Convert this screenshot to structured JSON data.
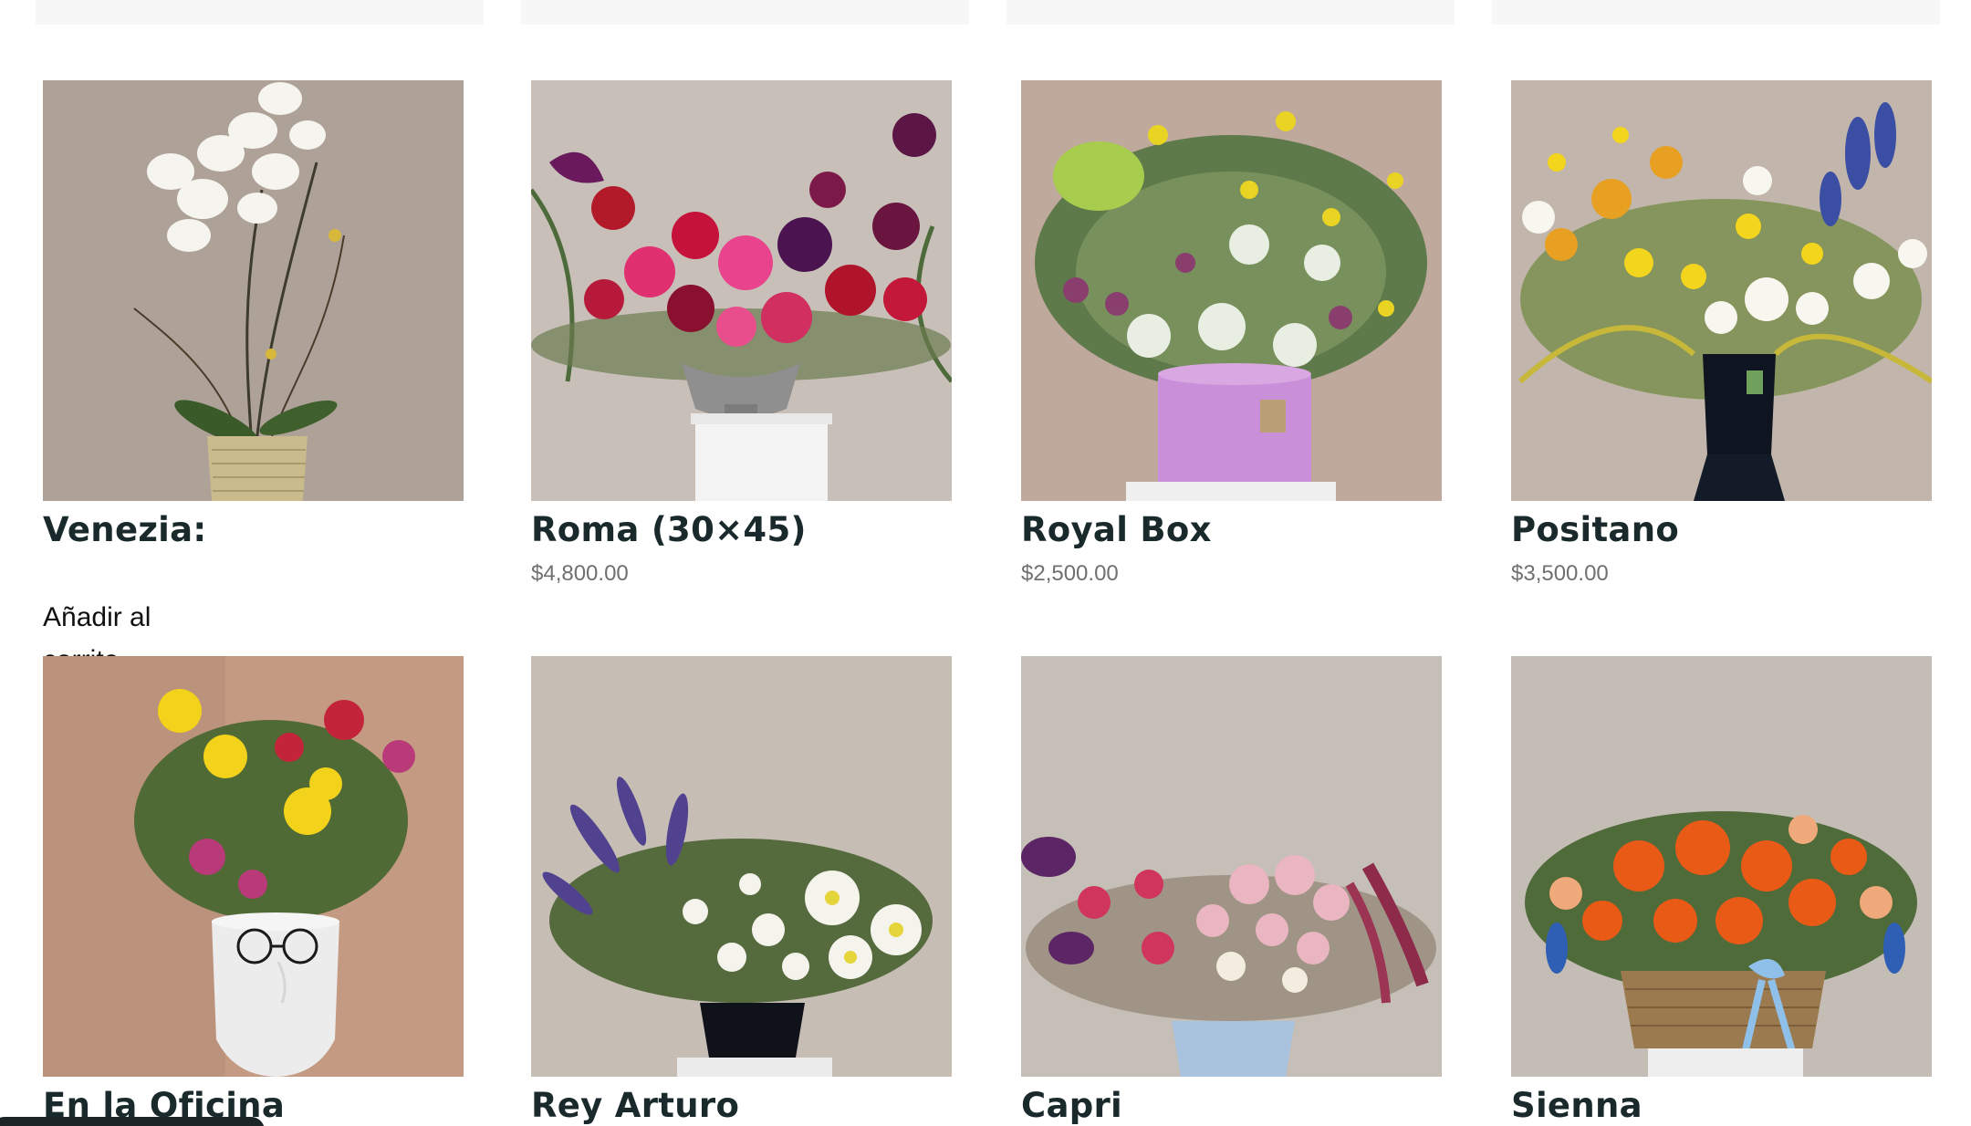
{
  "products": [
    {
      "title": "Venezia:",
      "price": "",
      "image_alt": "white orchid in ribbed gold pot",
      "cart_label": "Añadir al carrito"
    },
    {
      "title": "Roma (30×45)",
      "price": "$4,800.00",
      "image_alt": "red and pink roses in silver urn"
    },
    {
      "title": "Royal Box",
      "price": "$2,500.00",
      "image_alt": "green arrangement in lilac hat box"
    },
    {
      "title": "Positano",
      "price": "$3,500.00",
      "image_alt": "yellow and white flowers in black vase"
    },
    {
      "title": "En la Oficina",
      "price": "",
      "image_alt": "gerberas in face vase with glasses"
    },
    {
      "title": "Rey Arturo",
      "price": "",
      "image_alt": "white flowers and lavender in black vase"
    },
    {
      "title": "Capri",
      "price": "",
      "image_alt": "pink and purple flowers in pale blue vase"
    },
    {
      "title": "Sienna",
      "price": "",
      "image_alt": "orange gerberas in wicker basket"
    }
  ],
  "colors": {
    "title": "#1a2a2c",
    "price": "#707070",
    "wall": "#cfc7c0"
  }
}
